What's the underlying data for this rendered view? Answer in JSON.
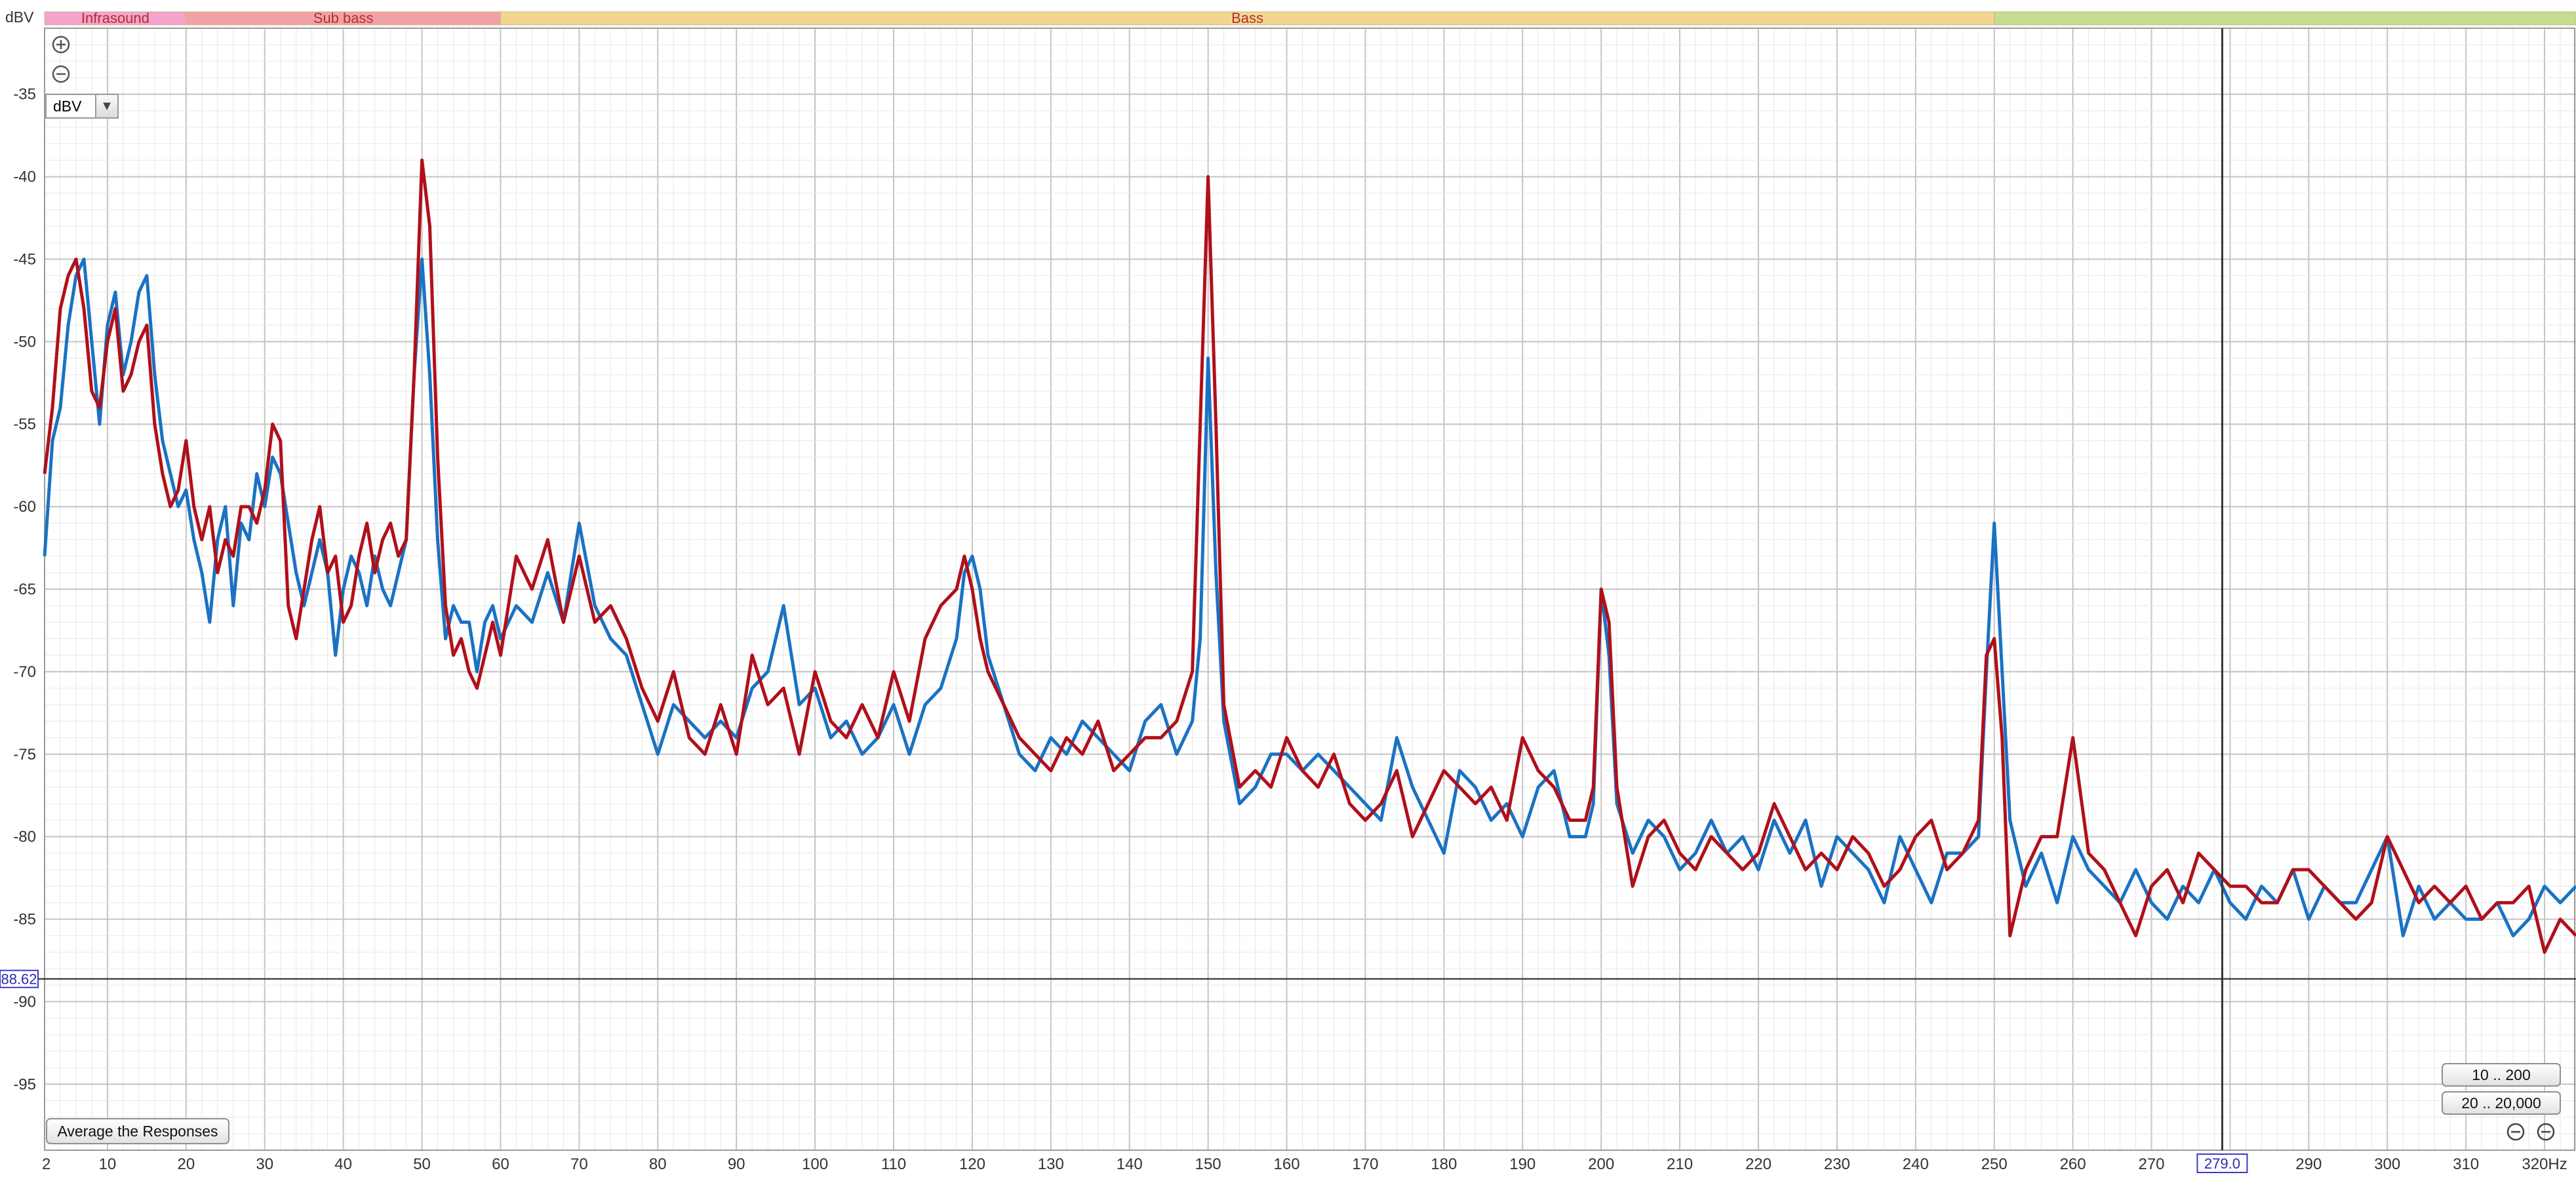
{
  "window": {
    "y_unit_label": "dBV",
    "x_unit_label": "Hz"
  },
  "bands": [
    {
      "name": "Infrasound",
      "from": 2,
      "to": 20,
      "color": "#f3a3cc"
    },
    {
      "name": "Sub bass",
      "from": 20,
      "to": 60,
      "color": "#f2a2a6"
    },
    {
      "name": "Bass",
      "from": 60,
      "to": 250,
      "color": "#f2d68f"
    },
    {
      "name": "",
      "from": 250,
      "to": 324,
      "color": "#c4dd8f"
    }
  ],
  "controls": {
    "unit_select": "dBV",
    "average_button": "Average the Responses",
    "range_10_200": "10 .. 200",
    "range_20_20000": "20 .. 20,000",
    "zoom_in_icon": "zoom-in-icon",
    "zoom_out_icon": "zoom-out-icon"
  },
  "cursor": {
    "y_readout": "88.62",
    "x_readout": "279.0",
    "y_value": -88.62,
    "x_value": 279.0
  },
  "colors": {
    "series_blue": "#1a72c4",
    "series_red": "#b0101a",
    "grid": "#d6d6d6",
    "axis_text": "#333333",
    "readout_border": "#3a3ac8"
  },
  "chart_data": {
    "type": "line",
    "xlabel": "Hz",
    "ylabel": "dBV",
    "xlim": [
      2,
      324
    ],
    "ylim": [
      -99,
      -31
    ],
    "grid": true,
    "x_ticks": [
      2,
      10,
      20,
      30,
      40,
      50,
      60,
      70,
      80,
      90,
      100,
      110,
      120,
      130,
      140,
      150,
      160,
      170,
      180,
      190,
      200,
      210,
      220,
      230,
      240,
      250,
      260,
      270,
      280,
      290,
      300,
      310,
      320
    ],
    "x_tick_labels": [
      "2",
      "10",
      "20",
      "30",
      "40",
      "50",
      "60",
      "70",
      "80",
      "90",
      "100",
      "110",
      "120",
      "130",
      "140",
      "150",
      "160",
      "170",
      "180",
      "190",
      "200",
      "210",
      "220",
      "230",
      "240",
      "250",
      "260",
      "270",
      "",
      "290",
      "300",
      "310",
      "320Hz"
    ],
    "y_ticks": [
      -35,
      -40,
      -45,
      -50,
      -55,
      -60,
      -65,
      -70,
      -75,
      -80,
      -85,
      -90,
      -95
    ],
    "series": [
      {
        "color": "#1a72c4",
        "x": [
          2,
          3,
          4,
          5,
          6,
          7,
          8,
          9,
          10,
          11,
          12,
          13,
          14,
          15,
          16,
          17,
          18,
          19,
          20,
          21,
          22,
          23,
          24,
          25,
          26,
          27,
          28,
          29,
          30,
          31,
          32,
          33,
          34,
          35,
          36,
          37,
          38,
          39,
          40,
          41,
          42,
          43,
          44,
          45,
          46,
          47,
          48,
          49,
          50,
          51,
          52,
          53,
          54,
          55,
          56,
          57,
          58,
          59,
          60,
          62,
          64,
          66,
          68,
          70,
          72,
          74,
          76,
          78,
          80,
          82,
          84,
          86,
          88,
          90,
          92,
          94,
          96,
          98,
          100,
          102,
          104,
          106,
          108,
          110,
          112,
          114,
          116,
          118,
          119,
          120,
          121,
          122,
          124,
          126,
          128,
          130,
          132,
          134,
          136,
          138,
          140,
          142,
          144,
          146,
          148,
          149,
          150,
          151,
          152,
          154,
          156,
          158,
          160,
          162,
          164,
          166,
          168,
          170,
          172,
          174,
          176,
          178,
          180,
          182,
          184,
          186,
          188,
          190,
          192,
          194,
          196,
          198,
          199,
          200,
          201,
          202,
          204,
          206,
          208,
          210,
          212,
          214,
          216,
          218,
          220,
          222,
          224,
          226,
          228,
          230,
          232,
          234,
          236,
          238,
          240,
          242,
          244,
          246,
          248,
          249,
          250,
          251,
          252,
          254,
          256,
          258,
          260,
          262,
          264,
          266,
          268,
          270,
          272,
          274,
          276,
          278,
          280,
          282,
          284,
          286,
          288,
          290,
          292,
          294,
          296,
          298,
          300,
          302,
          304,
          306,
          308,
          310,
          312,
          314,
          316,
          318,
          320,
          322,
          324
        ],
        "y": [
          -63,
          -56,
          -54,
          -49,
          -46,
          -45,
          -50,
          -55,
          -49,
          -47,
          -52,
          -50,
          -47,
          -46,
          -52,
          -56,
          -58,
          -60,
          -59,
          -62,
          -64,
          -67,
          -62,
          -60,
          -66,
          -61,
          -62,
          -58,
          -60,
          -57,
          -58,
          -61,
          -64,
          -66,
          -64,
          -62,
          -64,
          -69,
          -65,
          -63,
          -64,
          -66,
          -63,
          -65,
          -66,
          -64,
          -62,
          -52,
          -45,
          -52,
          -62,
          -68,
          -66,
          -67,
          -67,
          -70,
          -67,
          -66,
          -68,
          -66,
          -67,
          -64,
          -67,
          -61,
          -66,
          -68,
          -69,
          -72,
          -75,
          -72,
          -73,
          -74,
          -73,
          -74,
          -71,
          -70,
          -66,
          -72,
          -71,
          -74,
          -73,
          -75,
          -74,
          -72,
          -75,
          -72,
          -71,
          -68,
          -64,
          -63,
          -65,
          -69,
          -72,
          -75,
          -76,
          -74,
          -75,
          -73,
          -74,
          -75,
          -76,
          -73,
          -72,
          -75,
          -73,
          -68,
          -51,
          -64,
          -73,
          -78,
          -77,
          -75,
          -75,
          -76,
          -75,
          -76,
          -77,
          -78,
          -79,
          -74,
          -77,
          -79,
          -81,
          -76,
          -77,
          -79,
          -78,
          -80,
          -77,
          -76,
          -80,
          -80,
          -78,
          -65,
          -69,
          -78,
          -81,
          -79,
          -80,
          -82,
          -81,
          -79,
          -81,
          -80,
          -82,
          -79,
          -81,
          -79,
          -83,
          -80,
          -81,
          -82,
          -84,
          -80,
          -82,
          -84,
          -81,
          -81,
          -80,
          -70,
          -61,
          -70,
          -79,
          -83,
          -81,
          -84,
          -80,
          -82,
          -83,
          -84,
          -82,
          -84,
          -85,
          -83,
          -84,
          -82,
          -84,
          -85,
          -83,
          -84,
          -82,
          -85,
          -83,
          -84,
          -84,
          -82,
          -80,
          -86,
          -83,
          -85,
          -84,
          -85,
          -85,
          -84,
          -86,
          -85,
          -83,
          -84,
          -83
        ]
      },
      {
        "color": "#b0101a",
        "x": [
          2,
          3,
          4,
          5,
          6,
          7,
          8,
          9,
          10,
          11,
          12,
          13,
          14,
          15,
          16,
          17,
          18,
          19,
          20,
          21,
          22,
          23,
          24,
          25,
          26,
          27,
          28,
          29,
          30,
          31,
          32,
          33,
          34,
          35,
          36,
          37,
          38,
          39,
          40,
          41,
          42,
          43,
          44,
          45,
          46,
          47,
          48,
          49,
          50,
          51,
          52,
          53,
          54,
          55,
          56,
          57,
          58,
          59,
          60,
          62,
          64,
          66,
          68,
          70,
          72,
          74,
          76,
          78,
          80,
          82,
          84,
          86,
          88,
          90,
          92,
          94,
          96,
          98,
          100,
          102,
          104,
          106,
          108,
          110,
          112,
          114,
          116,
          118,
          119,
          120,
          121,
          122,
          124,
          126,
          128,
          130,
          132,
          134,
          136,
          138,
          140,
          142,
          144,
          146,
          148,
          149,
          150,
          151,
          152,
          154,
          156,
          158,
          160,
          162,
          164,
          166,
          168,
          170,
          172,
          174,
          176,
          178,
          180,
          182,
          184,
          186,
          188,
          190,
          192,
          194,
          196,
          198,
          199,
          200,
          201,
          202,
          204,
          206,
          208,
          210,
          212,
          214,
          216,
          218,
          220,
          222,
          224,
          226,
          228,
          230,
          232,
          234,
          236,
          238,
          240,
          242,
          244,
          246,
          248,
          249,
          250,
          251,
          252,
          254,
          256,
          258,
          260,
          262,
          264,
          266,
          268,
          270,
          272,
          274,
          276,
          278,
          280,
          282,
          284,
          286,
          288,
          290,
          292,
          294,
          296,
          298,
          300,
          302,
          304,
          306,
          308,
          310,
          312,
          314,
          316,
          318,
          320,
          322,
          324
        ],
        "y": [
          -58,
          -54,
          -48,
          -46,
          -45,
          -48,
          -53,
          -54,
          -50,
          -48,
          -53,
          -52,
          -50,
          -49,
          -55,
          -58,
          -60,
          -59,
          -56,
          -60,
          -62,
          -60,
          -64,
          -62,
          -63,
          -60,
          -60,
          -61,
          -59,
          -55,
          -56,
          -66,
          -68,
          -65,
          -62,
          -60,
          -64,
          -63,
          -67,
          -66,
          -63,
          -61,
          -64,
          -62,
          -61,
          -63,
          -62,
          -52,
          -39,
          -43,
          -57,
          -66,
          -69,
          -68,
          -70,
          -71,
          -69,
          -67,
          -69,
          -63,
          -65,
          -62,
          -67,
          -63,
          -67,
          -66,
          -68,
          -71,
          -73,
          -70,
          -74,
          -75,
          -72,
          -75,
          -69,
          -72,
          -71,
          -75,
          -70,
          -73,
          -74,
          -72,
          -74,
          -70,
          -73,
          -68,
          -66,
          -65,
          -63,
          -65,
          -68,
          -70,
          -72,
          -74,
          -75,
          -76,
          -74,
          -75,
          -73,
          -76,
          -75,
          -74,
          -74,
          -73,
          -70,
          -55,
          -40,
          -55,
          -72,
          -77,
          -76,
          -77,
          -74,
          -76,
          -77,
          -75,
          -78,
          -79,
          -78,
          -76,
          -80,
          -78,
          -76,
          -77,
          -78,
          -77,
          -79,
          -74,
          -76,
          -77,
          -79,
          -79,
          -77,
          -65,
          -67,
          -77,
          -83,
          -80,
          -79,
          -81,
          -82,
          -80,
          -81,
          -82,
          -81,
          -78,
          -80,
          -82,
          -81,
          -82,
          -80,
          -81,
          -83,
          -82,
          -80,
          -79,
          -82,
          -81,
          -79,
          -69,
          -68,
          -74,
          -86,
          -82,
          -80,
          -80,
          -74,
          -81,
          -82,
          -84,
          -86,
          -83,
          -82,
          -84,
          -81,
          -82,
          -83,
          -83,
          -84,
          -84,
          -82,
          -82,
          -83,
          -84,
          -85,
          -84,
          -80,
          -82,
          -84,
          -83,
          -84,
          -83,
          -85,
          -84,
          -84,
          -83,
          -87,
          -85,
          -86
        ]
      }
    ]
  }
}
